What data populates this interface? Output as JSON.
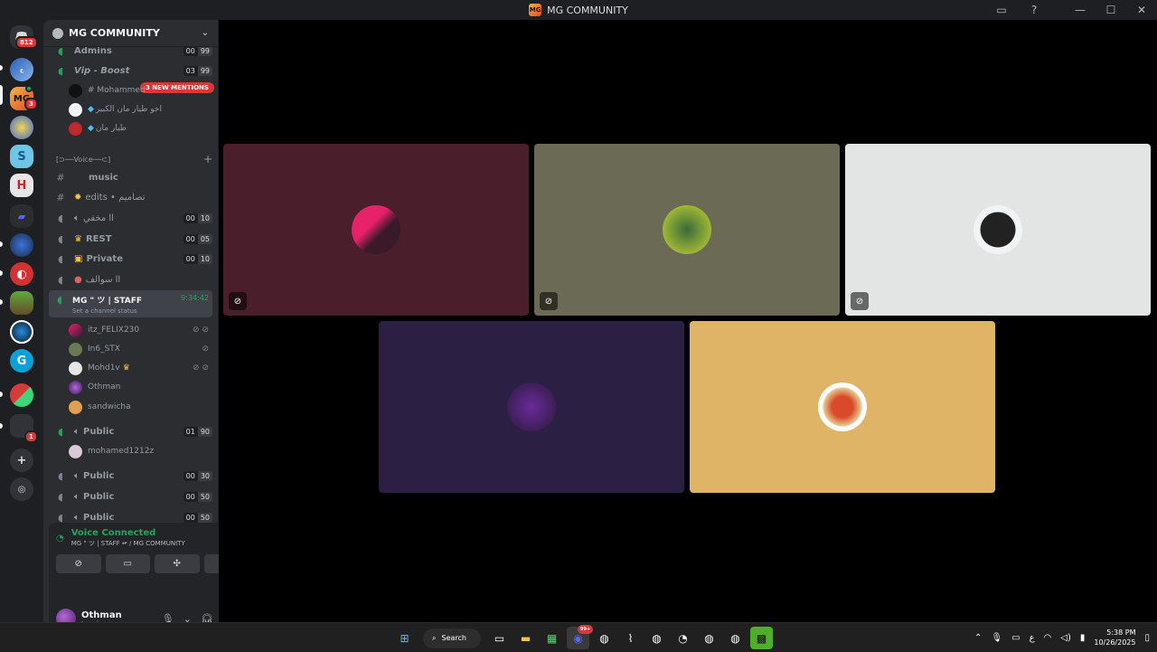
{
  "window": {
    "title": "MG COMMUNITY",
    "logo_text": "MG"
  },
  "guilds": {
    "dm_badge": "812",
    "mg_badge": "3",
    "last_badge": "1"
  },
  "server": {
    "name": "MG COMMUNITY"
  },
  "mentions": "3 NEW MENTIONS",
  "channels": {
    "admins": {
      "name": "Admins",
      "a": "00",
      "b": "99"
    },
    "vip": {
      "name": "Vip - Boost",
      "a": "03",
      "b": "99"
    },
    "vip_members": [
      "# Mohammed",
      "اخو طيار مان الكبير",
      "طيار مان"
    ],
    "category": "[⊃──Voice──⊂]",
    "music": "music",
    "edits": "edits • تصاميم",
    "mukhfi": {
      "name": "مخفي ll",
      "a": "00",
      "b": "10"
    },
    "rest": {
      "name": "REST",
      "a": "00",
      "b": "05"
    },
    "private": {
      "name": "Private",
      "a": "00",
      "b": "10"
    },
    "sawalif": "سوالف ll",
    "staff": {
      "name": "MG \" ツ | STAFF",
      "timer": "9:34:42",
      "status": "Set a channel status"
    },
    "staff_members": [
      "itz_FELIX230",
      "In6_STX",
      "Mohd1v",
      "Othman",
      "sandwicha"
    ],
    "public1": {
      "name": "Public",
      "a": "01",
      "b": "90"
    },
    "public1_members": [
      "mohamed1212z"
    ],
    "public2": {
      "name": "Public",
      "a": "00",
      "b": "30"
    },
    "public3": {
      "name": "Public",
      "a": "00",
      "b": "50"
    },
    "public4": {
      "name": "Public",
      "a": "00",
      "b": "50"
    }
  },
  "voice": {
    "state": "Voice Connected",
    "location": "MG \" ツ | STAFF ↫ / MG COMMUNITY"
  },
  "user": {
    "name": "Othman",
    "status": "In voice"
  },
  "taskbar": {
    "search": "Search",
    "time": "5:38 PM",
    "date": "10/26/2025",
    "lang": "ع",
    "discord_badge": "99+"
  },
  "colors": {
    "tile1": "#4a1f2b",
    "tile2": "#6b6b55",
    "tile3": "#e3e4e4",
    "tile4": "#2b1f44",
    "tile5": "#dfb466",
    "green": "#23a55a",
    "red": "#da373c"
  }
}
